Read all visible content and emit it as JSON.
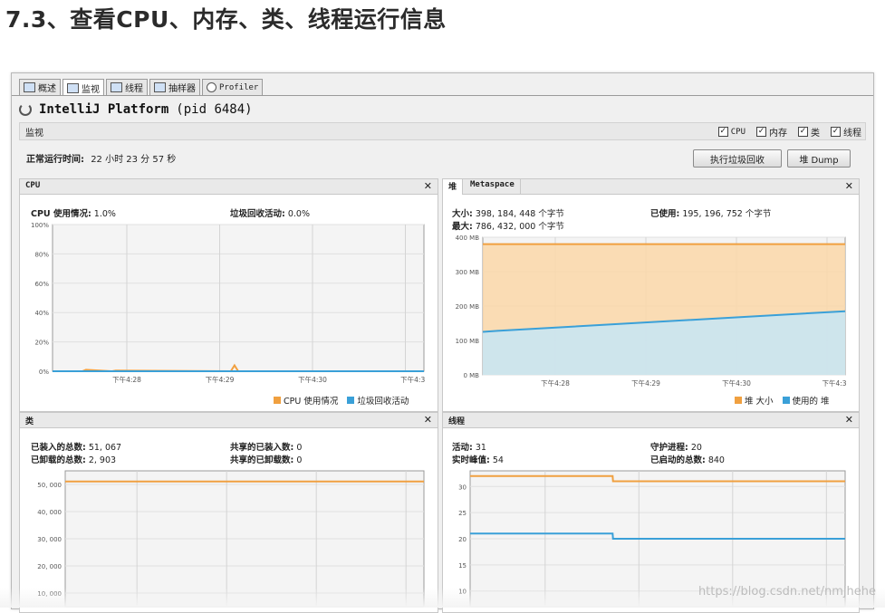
{
  "heading": "7.3、查看CPU、内存、类、线程运行信息",
  "tabs": [
    {
      "label": "概述"
    },
    {
      "label": "监视"
    },
    {
      "label": "线程"
    },
    {
      "label": "抽样器"
    },
    {
      "label": "Profiler"
    }
  ],
  "app": {
    "name": "IntelliJ Platform",
    "pid": "(pid 6484)"
  },
  "monitor": {
    "label": "监视",
    "checks": [
      {
        "label": "CPU",
        "checked": true
      },
      {
        "label": "内存",
        "checked": true
      },
      {
        "label": "类",
        "checked": true
      },
      {
        "label": "线程",
        "checked": true
      }
    ]
  },
  "uptime": {
    "label": "正常运行时间:",
    "value": "22 小时 23 分 57 秒"
  },
  "buttons": {
    "gc": "执行垃圾回收",
    "dump": "堆 Dump"
  },
  "colors": {
    "orange": "#f0a040",
    "blue": "#3aa0d8",
    "orange_fill": "#fad7a8",
    "blue_fill": "#c6e6f6"
  },
  "cpu_panel": {
    "title": "CPU",
    "usage_label": "CPU 使用情况:",
    "usage_value": "1.0%",
    "gc_label": "垃圾回收活动:",
    "gc_value": "0.0%",
    "legend": [
      "CPU 使用情况",
      "垃圾回收活动"
    ]
  },
  "heap_panel": {
    "tabs": [
      "堆",
      "Metaspace"
    ],
    "size_label": "大小:",
    "size_value": "398, 184, 448 个字节",
    "max_label": "最大:",
    "max_value": "786, 432, 000 个字节",
    "used_label": "已使用:",
    "used_value": "195, 196, 752 个字节",
    "legend": [
      "堆 大小",
      "使用的 堆"
    ]
  },
  "classes_panel": {
    "title": "类",
    "loaded_label": "已装入的总数:",
    "loaded_value": "51, 067",
    "unloaded_label": "已卸载的总数:",
    "unloaded_value": "2, 903",
    "shared_loaded_label": "共享的已装入数:",
    "shared_loaded_value": "0",
    "shared_unloaded_label": "共享的已卸载数:",
    "shared_unloaded_value": "0"
  },
  "threads_panel": {
    "title": "线程",
    "live_label": "活动:",
    "live_value": "31",
    "peak_label": "实时峰值:",
    "peak_value": "54",
    "daemon_label": "守护进程:",
    "daemon_value": "20",
    "started_label": "已启动的总数:",
    "started_value": "840"
  },
  "chart_data": [
    {
      "type": "line",
      "name_ref": "cpu",
      "x_ticks": [
        "下午4:28",
        "下午4:29",
        "下午4:30",
        "下午4:3"
      ],
      "y_ticks": [
        "100%",
        "80%",
        "60%",
        "40%",
        "20%",
        "0%"
      ],
      "ylim": [
        0,
        100
      ],
      "series": [
        {
          "name": "CPU 使用情况",
          "color": "#f0a040",
          "x": [
            0,
            8,
            9,
            16,
            17,
            48,
            49,
            50,
            100
          ],
          "values": [
            0,
            0,
            1,
            0,
            0.5,
            0,
            4,
            0,
            0
          ]
        },
        {
          "name": "垃圾回收活动",
          "color": "#3aa0d8",
          "x": [
            0,
            100
          ],
          "values": [
            0,
            0
          ]
        }
      ]
    },
    {
      "type": "area",
      "name_ref": "heap",
      "x_ticks": [
        "下午4:28",
        "下午4:29",
        "下午4:30",
        "下午4:3"
      ],
      "y_ticks": [
        "400 MB",
        "300 MB",
        "200 MB",
        "100 MB",
        "0 MB"
      ],
      "ylim": [
        0,
        400
      ],
      "series": [
        {
          "name": "堆 大小",
          "color": "#f0a040",
          "x": [
            0,
            100
          ],
          "values": [
            380,
            380
          ]
        },
        {
          "name": "使用的 堆",
          "color": "#3aa0d8",
          "x": [
            0,
            4,
            100
          ],
          "values": [
            125,
            128,
            185
          ]
        }
      ]
    },
    {
      "type": "line",
      "name_ref": "classes",
      "y_ticks": [
        "50, 000",
        "40, 000",
        "30, 000",
        "20, 000",
        "10, 000"
      ],
      "ylim": [
        5000,
        55000
      ],
      "series": [
        {
          "name": "已装入的总数",
          "color": "#f0a040",
          "x": [
            0,
            100
          ],
          "values": [
            51067,
            51067
          ]
        }
      ]
    },
    {
      "type": "line",
      "name_ref": "threads",
      "y_ticks": [
        "30",
        "25",
        "20",
        "15",
        "10"
      ],
      "ylim": [
        7,
        33
      ],
      "series": [
        {
          "name": "活动",
          "color": "#f0a040",
          "x": [
            0,
            38,
            38.1,
            100
          ],
          "values": [
            32,
            32,
            31,
            31
          ]
        },
        {
          "name": "守护进程",
          "color": "#3aa0d8",
          "x": [
            0,
            38,
            38.1,
            100
          ],
          "values": [
            21,
            21,
            20,
            20
          ]
        }
      ]
    }
  ]
}
